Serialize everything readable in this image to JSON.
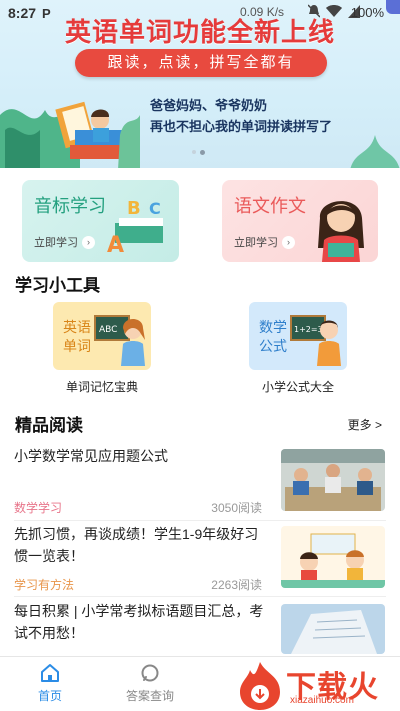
{
  "status_bar": {
    "time": "8:27",
    "notification": "P",
    "network_speed": "0.09 K/s",
    "battery": "100%"
  },
  "banner": {
    "title": "英语单词功能全新上线",
    "pill_text": "跟读，点读，拼写全都有",
    "subtitle_line1": "爸爸妈妈、爷爷奶奶",
    "subtitle_line2": "再也不担心我的单词拼读拼写了"
  },
  "categories": [
    {
      "title": "音标学习",
      "link": "立即学习"
    },
    {
      "title": "语文作文",
      "link": "立即学习"
    }
  ],
  "tools": {
    "title": "学习小工具",
    "items": [
      {
        "card_text": "英语单词",
        "label": "单词记忆宝典"
      },
      {
        "card_text": "数学公式",
        "label": "小学公式大全"
      }
    ]
  },
  "reading": {
    "title": "精品阅读",
    "more": "更多 >",
    "articles": [
      {
        "title": "小学数学常见应用题公式",
        "tag": "数学学习",
        "reads": "3050阅读"
      },
      {
        "title": "先抓习惯，再谈成绩！学生1-9年级好习惯一览表！",
        "tag": "学习有方法",
        "reads": "2263阅读"
      },
      {
        "title": "每日积累 | 小学常考拟标语题目汇总，考试不用愁！",
        "tag": "",
        "reads": ""
      }
    ]
  },
  "bottom_nav": [
    {
      "label": "首页",
      "icon": "home-icon",
      "active": true
    },
    {
      "label": "答案查询",
      "icon": "search-icon",
      "active": false
    }
  ],
  "watermark": {
    "text": "下载火",
    "url": "xiazaihuo.com"
  },
  "colors": {
    "accent_blue": "#2b8ce6",
    "banner_red": "#e53b3b",
    "tag_pink": "#e8758a",
    "tag_orange": "#e8954a"
  }
}
